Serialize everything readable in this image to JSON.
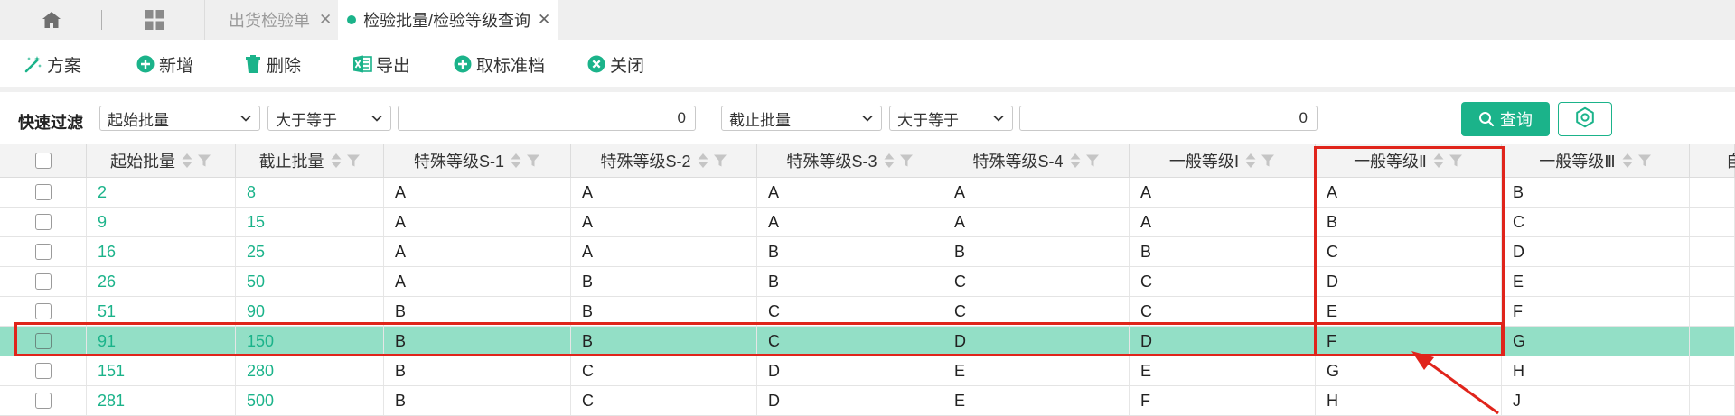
{
  "tabs": {
    "home_icon": "home-icon",
    "apps_icon": "grid-icon",
    "items": [
      {
        "label": "出货检验单",
        "close": "✕",
        "active": false
      },
      {
        "label": "检验批量/检验等级查询",
        "close": "✕",
        "active": true
      }
    ]
  },
  "toolbar": {
    "buttons": [
      {
        "label": "方案",
        "icon": "scheme-icon"
      },
      {
        "label": "新增",
        "icon": "add-icon"
      },
      {
        "label": "删除",
        "icon": "trash-icon"
      },
      {
        "label": "导出",
        "icon": "excel-icon"
      },
      {
        "label": "取标准档",
        "icon": "fetch-standard-icon"
      },
      {
        "label": "关闭",
        "icon": "close-circle-icon"
      }
    ]
  },
  "filter": {
    "label": "快速过滤",
    "field1": "起始批量",
    "op1": "大于等于",
    "value1": "0",
    "field2": "截止批量",
    "op2": "大于等于",
    "value2": "0",
    "query_label": "查询"
  },
  "table": {
    "columns": [
      "起始批量",
      "截止批量",
      "特殊等级S-1",
      "特殊等级S-2",
      "特殊等级S-3",
      "特殊等级S-4",
      "一般等级Ⅰ",
      "一般等级Ⅱ",
      "一般等级Ⅲ",
      "自"
    ],
    "rows": [
      [
        "2",
        "8",
        "A",
        "A",
        "A",
        "A",
        "A",
        "A",
        "B"
      ],
      [
        "9",
        "15",
        "A",
        "A",
        "A",
        "A",
        "A",
        "B",
        "C"
      ],
      [
        "16",
        "25",
        "A",
        "A",
        "B",
        "B",
        "B",
        "C",
        "D"
      ],
      [
        "26",
        "50",
        "A",
        "B",
        "B",
        "C",
        "C",
        "D",
        "E"
      ],
      [
        "51",
        "90",
        "B",
        "B",
        "C",
        "C",
        "C",
        "E",
        "F"
      ],
      [
        "91",
        "150",
        "B",
        "B",
        "C",
        "D",
        "D",
        "F",
        "G"
      ],
      [
        "151",
        "280",
        "B",
        "C",
        "D",
        "E",
        "E",
        "G",
        "H"
      ],
      [
        "281",
        "500",
        "B",
        "C",
        "D",
        "E",
        "F",
        "H",
        "J"
      ]
    ],
    "selected_row": 5
  },
  "colors": {
    "accent": "#1bb38a",
    "selected_row": "#93dfc6",
    "annotation": "#e0241b"
  }
}
